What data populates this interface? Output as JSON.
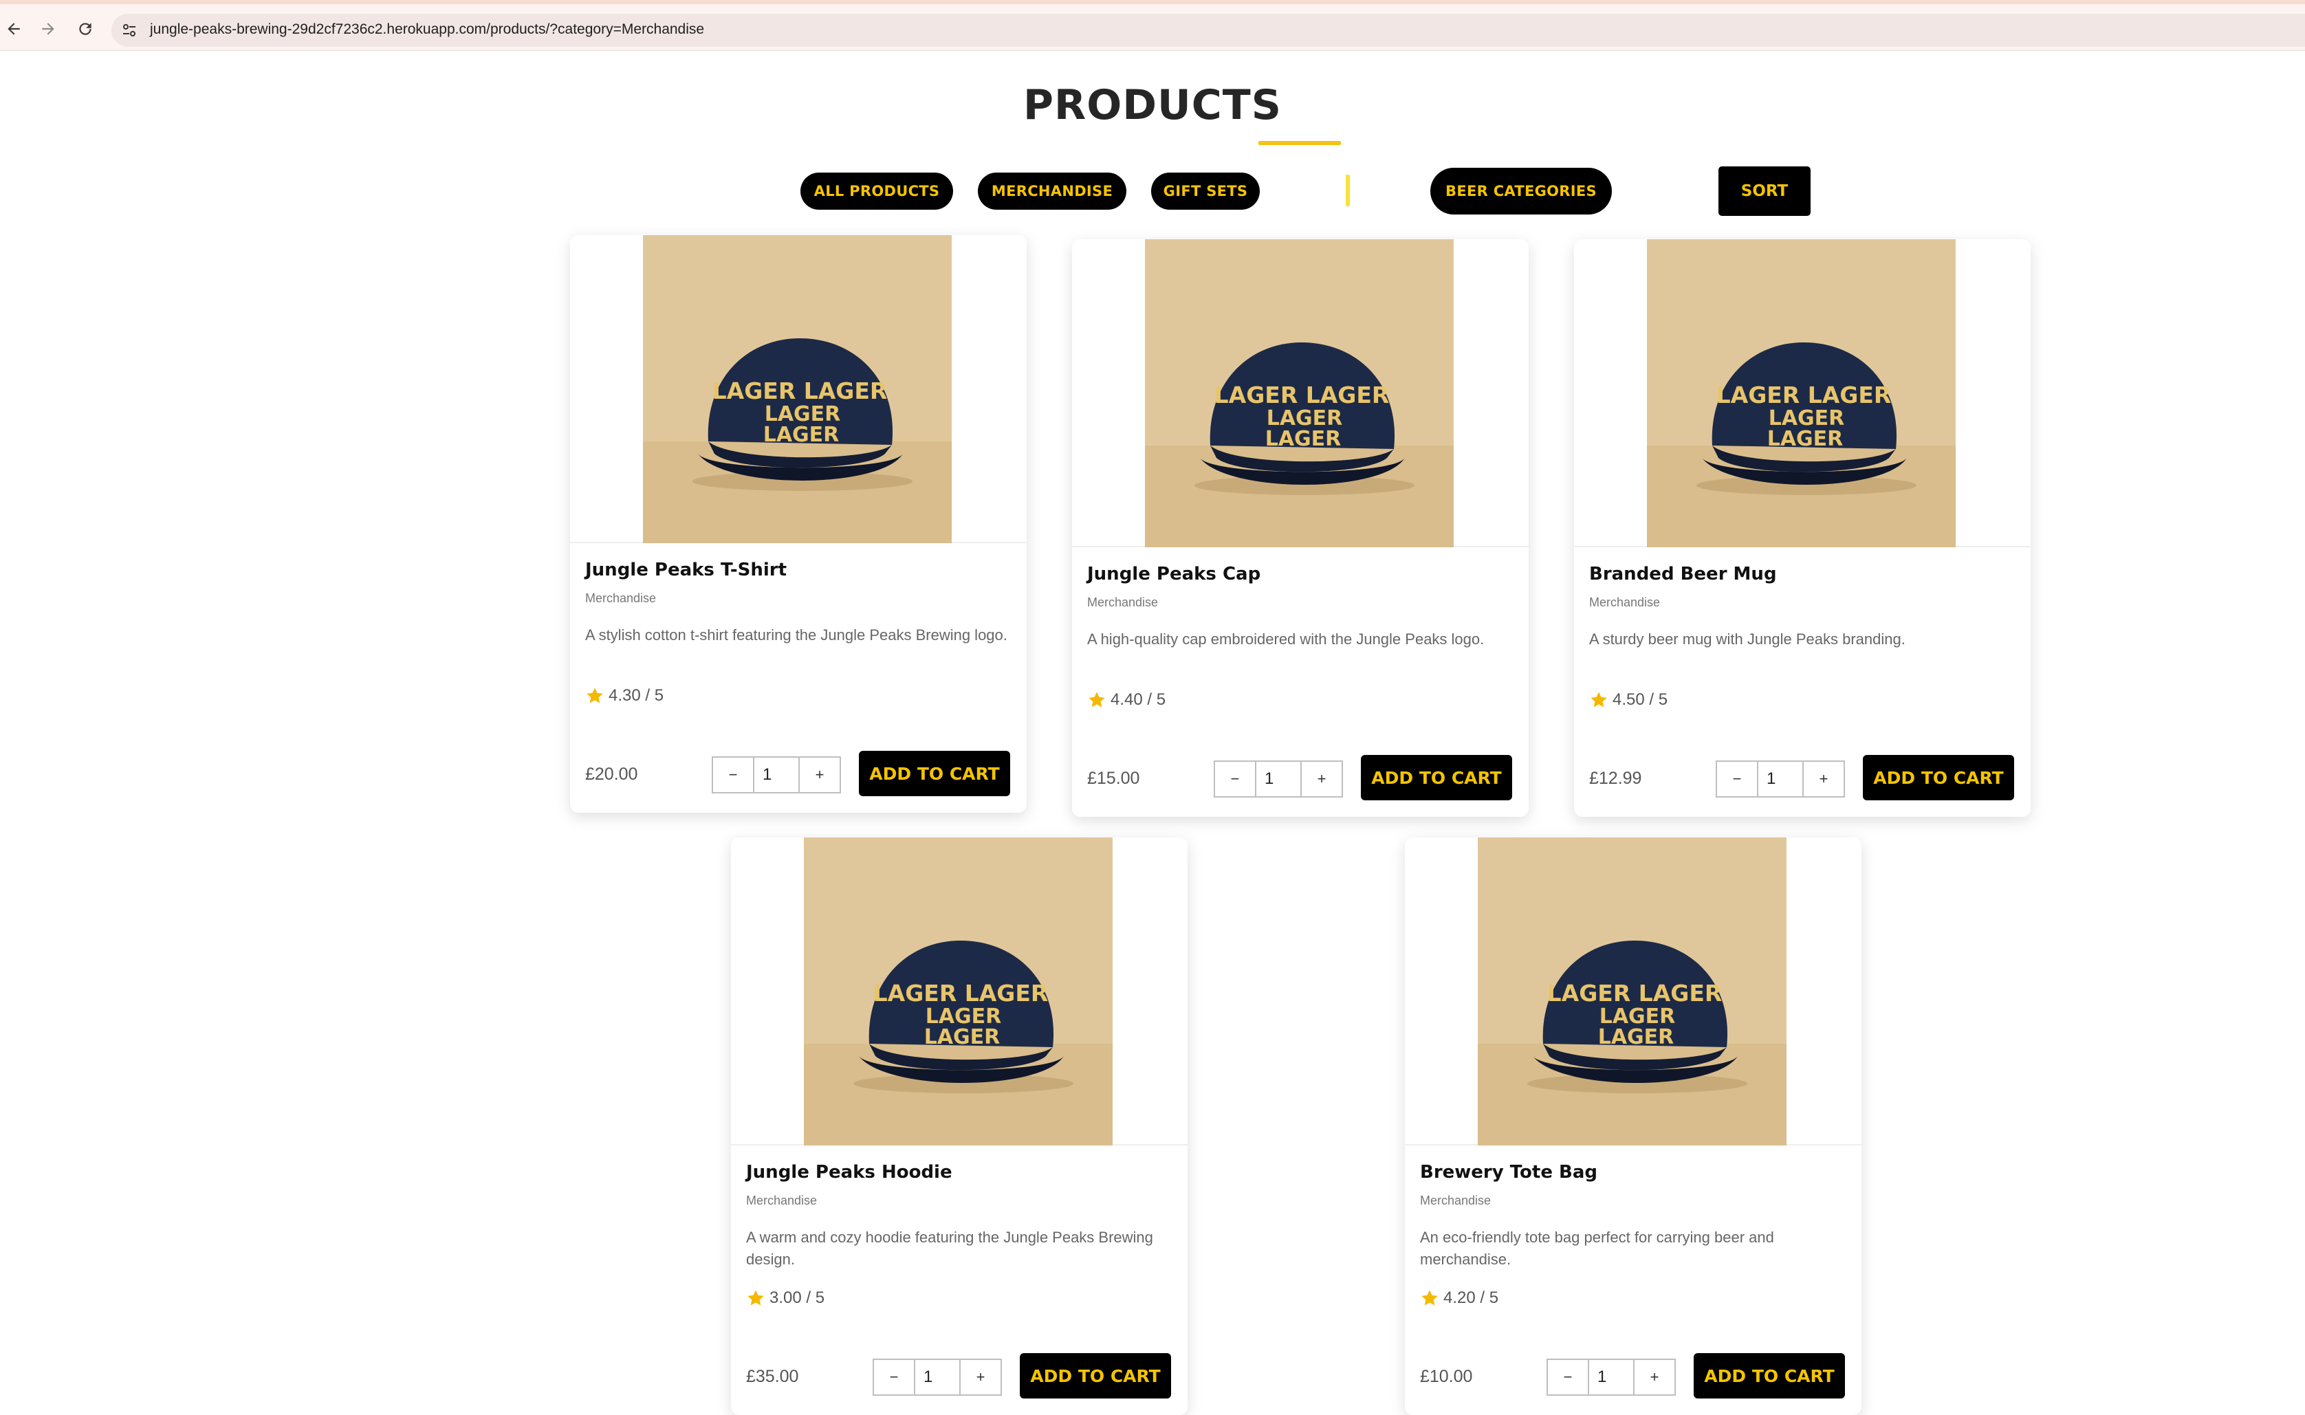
{
  "browser": {
    "url": "jungle-peaks-brewing-29d2cf7236c2.herokuapp.com/products/?category=Merchandise",
    "back_icon": "arrow-left-icon",
    "forward_icon": "arrow-right-icon",
    "reload_icon": "reload-icon",
    "site_info_icon": "tune-icon"
  },
  "page": {
    "title": "PRODUCTS",
    "accent_color": "#f4c316",
    "filters": [
      "ALL PRODUCTS",
      "MERCHANDISE",
      "GIFT SETS"
    ],
    "beer_categories_label": "BEER CATEGORIES",
    "sort_label": "SORT"
  },
  "products": [
    {
      "name": "Jungle Peaks T-Shirt",
      "category": "Merchandise",
      "description": "A stylish cotton t-shirt featuring the Jungle Peaks Brewing logo.",
      "rating": "4.30 / 5",
      "price": "£20.00",
      "qty": "1",
      "minus": "−",
      "plus": "+",
      "add_label": "ADD TO CART",
      "image_icon": "lager-cap-image"
    },
    {
      "name": "Jungle Peaks Cap",
      "category": "Merchandise",
      "description": "A high-quality cap embroidered with the Jungle Peaks logo.",
      "rating": "4.40 / 5",
      "price": "£15.00",
      "qty": "1",
      "minus": "−",
      "plus": "+",
      "add_label": "ADD TO CART",
      "image_icon": "lager-cap-image"
    },
    {
      "name": "Branded Beer Mug",
      "category": "Merchandise",
      "description": "A sturdy beer mug with Jungle Peaks branding.",
      "rating": "4.50 / 5",
      "price": "£12.99",
      "qty": "1",
      "minus": "−",
      "plus": "+",
      "add_label": "ADD TO CART",
      "image_icon": "lager-cap-image"
    },
    {
      "name": "Jungle Peaks Hoodie",
      "category": "Merchandise",
      "description": "A warm and cozy hoodie featuring the Jungle Peaks Brewing design.",
      "rating": "3.00 / 5",
      "price": "£35.00",
      "qty": "1",
      "minus": "−",
      "plus": "+",
      "add_label": "ADD TO CART",
      "image_icon": "lager-cap-image"
    },
    {
      "name": "Brewery Tote Bag",
      "category": "Merchandise",
      "description": "An eco-friendly tote bag perfect for carrying beer and merchandise.",
      "rating": "4.20 / 5",
      "price": "£10.00",
      "qty": "1",
      "minus": "−",
      "plus": "+",
      "add_label": "ADD TO CART",
      "image_icon": "lager-cap-image"
    }
  ],
  "cap_image": {
    "line1": "LAGER LAGER",
    "line2": "LAGER",
    "line3": "LAGER"
  }
}
